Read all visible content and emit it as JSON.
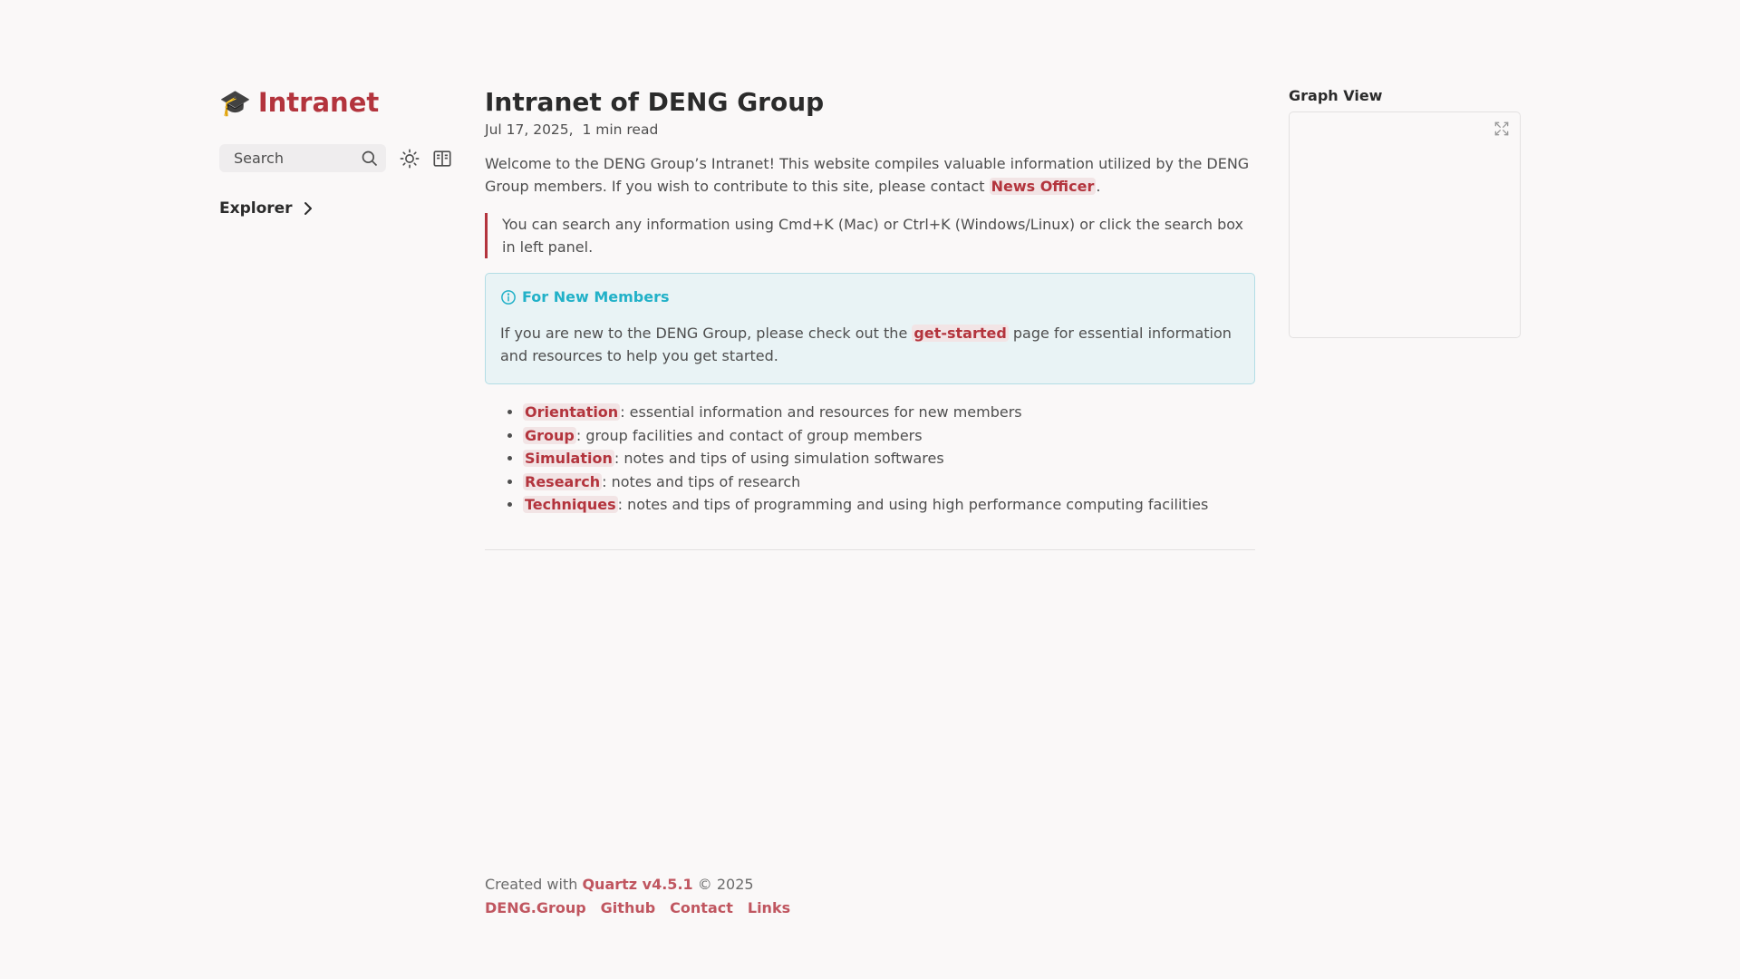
{
  "sidebar": {
    "site_icon": "🎓",
    "site_name": "Intranet",
    "search_label": "Search",
    "explorer_label": "Explorer"
  },
  "article": {
    "title": "Intranet of DENG Group",
    "date": "Jul 17, 2025,",
    "read_time": "1 min read",
    "intro_text": "Welcome to the DENG Group’s Intranet! This website compiles valuable information utilized by the DENG Group members. If you wish to contribute to this site, please contact",
    "intro_link": "News Officer",
    "intro_end": ".",
    "quote": "You can search any information using Cmd+K (Mac) or Ctrl+K (Windows/Linux) or click the search box in left panel.",
    "callout": {
      "title": "For New Members",
      "text_before": "If you are new to the DENG Group, please check out the",
      "link": "get-started",
      "text_after": "page for essential information and resources to help you get started."
    },
    "topics": [
      {
        "link": "Orientation",
        "desc": ": essential information and resources for new members"
      },
      {
        "link": "Group",
        "desc": ": group facilities and contact of group members"
      },
      {
        "link": "Simulation",
        "desc": ": notes and tips of using simulation softwares"
      },
      {
        "link": "Research",
        "desc": ": notes and tips of research"
      },
      {
        "link": "Techniques",
        "desc": ": notes and tips of programming and using high performance computing facilities"
      }
    ]
  },
  "footer": {
    "created_with": "Created with",
    "quartz": "Quartz v4.5.1",
    "copyright": "© 2025",
    "links": [
      "DENG.Group",
      "Github",
      "Contact",
      "Links"
    ]
  },
  "graph": {
    "title": "Graph View"
  },
  "colors": {
    "accent": "#b3343d",
    "callout": "#22b1c8"
  }
}
